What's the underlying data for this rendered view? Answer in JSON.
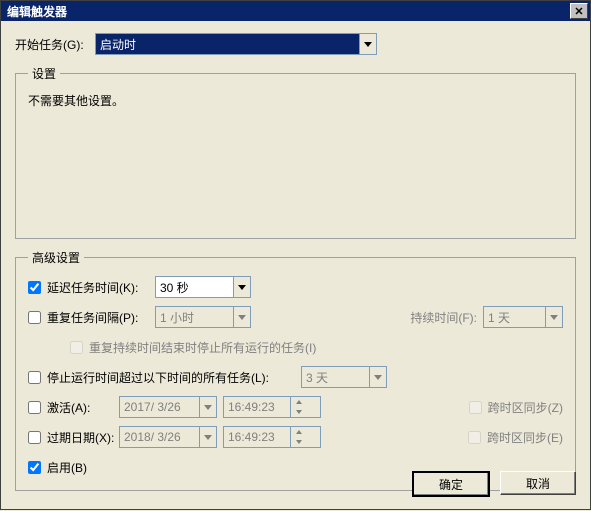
{
  "window": {
    "title": "编辑触发器"
  },
  "begin": {
    "label": "开始任务(G):",
    "value": "启动时"
  },
  "settings": {
    "legend": "设置",
    "text": "不需要其他设置。"
  },
  "advanced": {
    "legend": "高级设置",
    "delay": {
      "checked": true,
      "label": "延迟任务时间(K):",
      "value": "30 秒"
    },
    "repeat": {
      "checked": false,
      "label": "重复任务间隔(P):",
      "value": "1 小时",
      "duration_label": "持续时间(F):",
      "duration_value": "1 天"
    },
    "repeat_stop": {
      "checked": false,
      "label": "重复持续时间结束时停止所有运行的任务(I)"
    },
    "stop_after": {
      "checked": false,
      "label": "停止运行时间超过以下时间的所有任务(L):",
      "value": "3 天"
    },
    "activate": {
      "checked": false,
      "label": "激活(A):",
      "date": "2017/ 3/26",
      "time": "16:49:23",
      "tz_checked": false,
      "tz_label": "跨时区同步(Z)"
    },
    "expire": {
      "checked": false,
      "label": "过期日期(X):",
      "date": "2018/ 3/26",
      "time": "16:49:23",
      "tz_checked": false,
      "tz_label": "跨时区同步(E)"
    },
    "enabled": {
      "checked": true,
      "label": "启用(B)"
    }
  },
  "buttons": {
    "ok": "确定",
    "cancel": "取消"
  }
}
